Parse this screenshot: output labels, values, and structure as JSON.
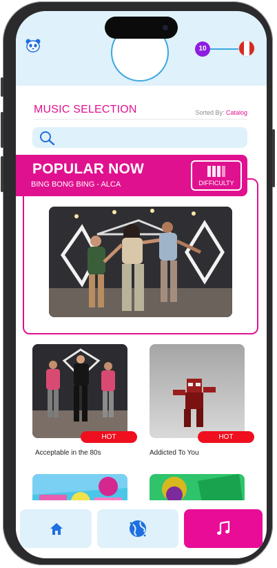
{
  "header": {
    "level": "10",
    "flag_colors": [
      "#d52b1e",
      "#ffffff",
      "#d52b1e"
    ]
  },
  "selection": {
    "title": "MUSIC SELECTION",
    "sorted_prefix": "Sorted By: ",
    "sorted_value": "Catalog",
    "search_placeholder": ""
  },
  "popular": {
    "title": "POPULAR NOW",
    "subtitle": "BING BONG BING - ALCA",
    "difficulty_label": "DIFFICULTY",
    "difficulty_level": 3,
    "difficulty_max": 4
  },
  "songs": [
    {
      "name": "Acceptable in the 80s",
      "badge": "HOT"
    },
    {
      "name": "Addicted To You",
      "badge": "HOT"
    }
  ],
  "nav": {
    "items": [
      "home-icon",
      "world-icon",
      "music-note-icon"
    ],
    "active": "music-note-icon"
  },
  "colors": {
    "accent": "#e0118f",
    "hot": "#ef0f1e",
    "light_blue": "#dff1fb",
    "icon_blue": "#1f6fe0"
  }
}
